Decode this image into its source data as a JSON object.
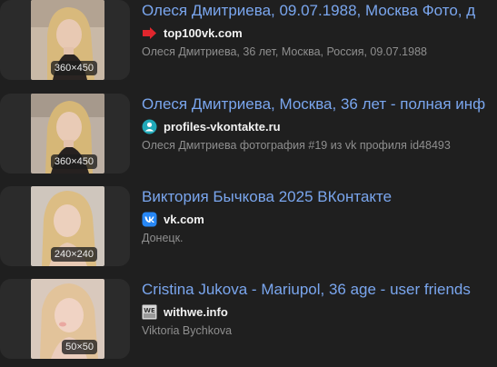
{
  "results": [
    {
      "title": "Олеся Дмитриева, 09.07.1988, Москва Фото, д",
      "domain": "top100vk.com",
      "favicon": "red-arrow-icon",
      "snippet": "Олеся Дмитриева, 36 лет, Москва, Россия, 09.07.1988",
      "size": "360×450"
    },
    {
      "title": "Олеся Дмитриева, Москва, 36 лет - полная инф",
      "domain": "profiles-vkontakte.ru",
      "favicon": "teal-person-icon",
      "snippet": "Олеся Дмитриева фотография #19 из vk профиля id48493",
      "size": "360×450"
    },
    {
      "title": "Виктория Бычкова 2025 ВКонтакте",
      "domain": "vk.com",
      "favicon": "vk-logo-icon",
      "snippet": "Донецк.",
      "size": "240×240"
    },
    {
      "title": "Cristina Jukova - Mariupol, 36 age - user friends",
      "domain": "withwe.info",
      "favicon": "we-logo-icon",
      "snippet": "Viktoria Bychkova",
      "size": "50×50"
    }
  ],
  "colors": {
    "background": "#1f1f1f",
    "title_link": "#7aa6ee",
    "snippet": "#8f8f8f",
    "domain": "#f2f2f2"
  }
}
